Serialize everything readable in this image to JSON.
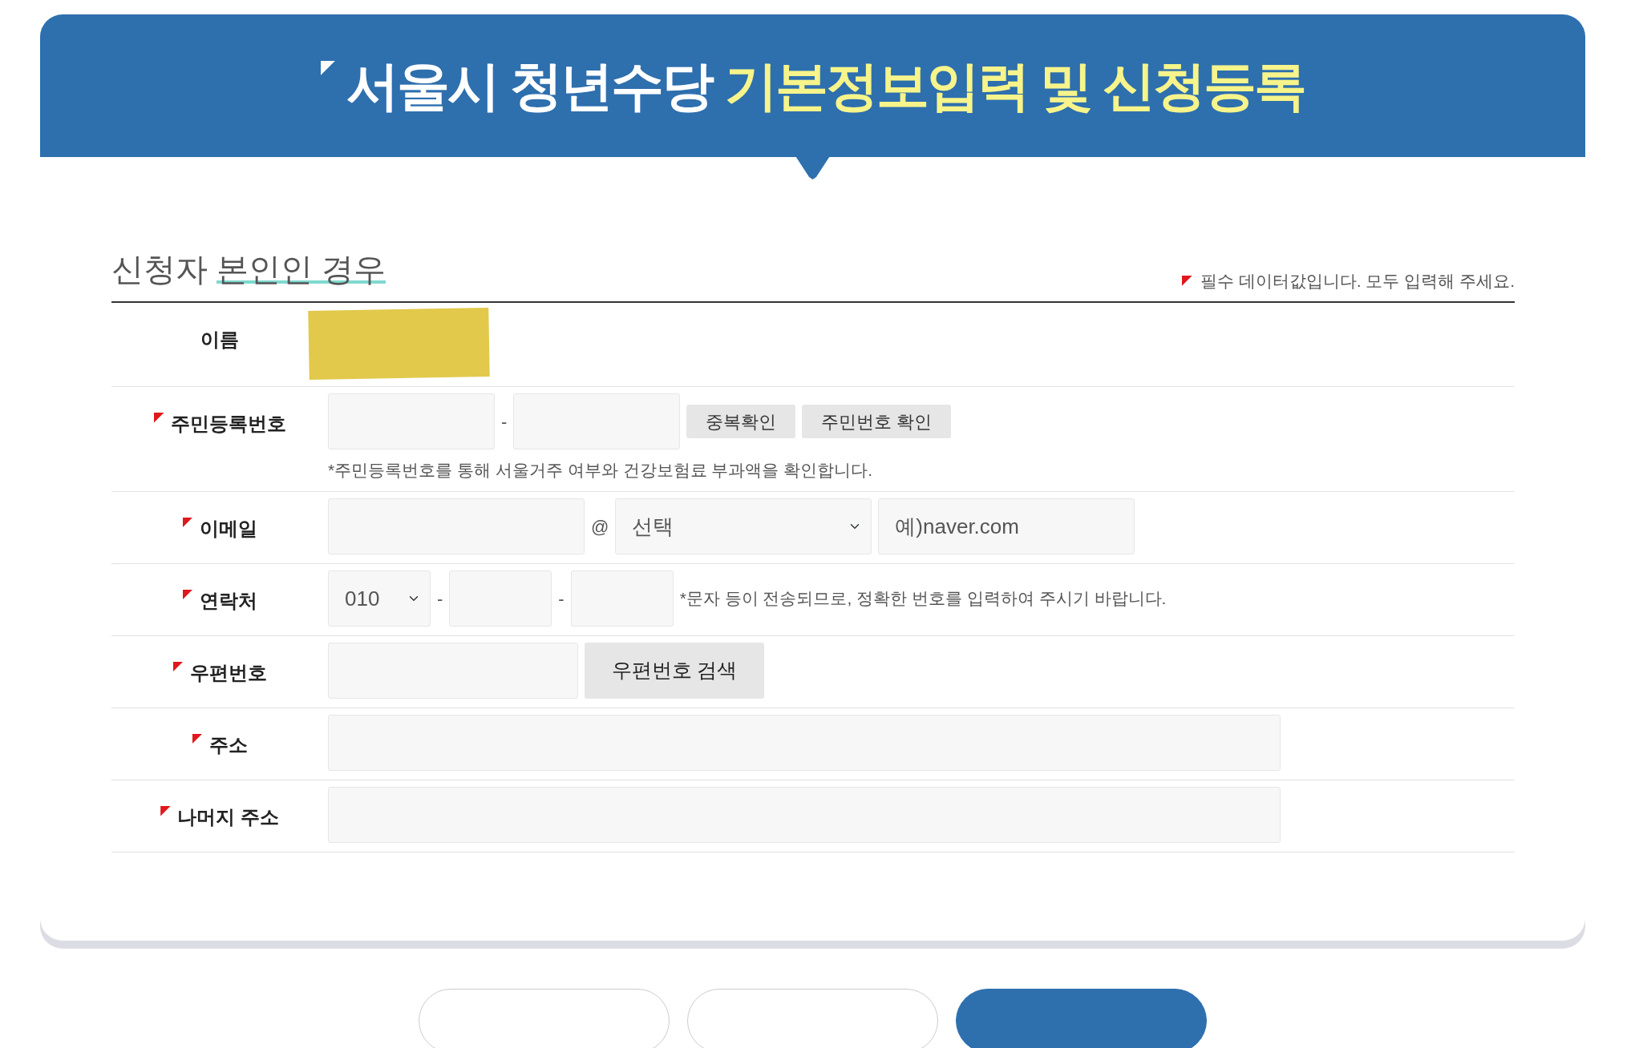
{
  "header": {
    "title": "서울시 청년수당",
    "title_highlight": "기본정보입력 및 신청등록"
  },
  "section": {
    "title": "신청자",
    "title_underlined": "본인인 경우",
    "required_note": "필수 데이터값입니다. 모두 입력해 주세요."
  },
  "rows": [
    {
      "kind": "redacted",
      "label": "이름",
      "required": false
    },
    {
      "kind": "ssn",
      "label": "주민등록번호",
      "required": true,
      "separator": "-",
      "buttons": [
        "중복확인",
        "주민번호 확인"
      ],
      "help": "*주민등록번호를 통해 서울거주 여부와 건강보험료 부과액을 확인합니다."
    },
    {
      "kind": "email",
      "label": "이메일",
      "required": true,
      "at": "@",
      "select_value": "선택",
      "domain_placeholder": "예)naver.com"
    },
    {
      "kind": "phone",
      "label": "연락처",
      "required": true,
      "select_value": "010",
      "separator": "-",
      "help": "*문자 등이 전송되므로, 정확한 번호를 입력하여 주시기 바랍니다."
    },
    {
      "kind": "zip",
      "label": "우편번호",
      "required": true,
      "button": "우편번호 검색"
    },
    {
      "kind": "text",
      "label": "주소",
      "required": true
    },
    {
      "kind": "text",
      "label": "나머지 주소",
      "required": true
    }
  ],
  "bottom_buttons": [
    {
      "kind": "outline"
    },
    {
      "kind": "outline"
    },
    {
      "kind": "primary"
    }
  ]
}
